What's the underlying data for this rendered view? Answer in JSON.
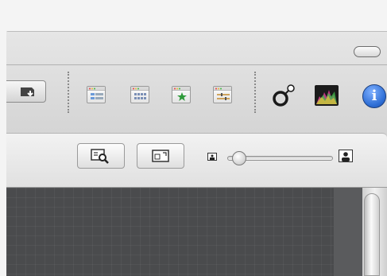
{
  "toolbar": {
    "left_button_icon": "folder-arrow-icon",
    "view_icons": [
      {
        "name": "list-view-icon"
      },
      {
        "name": "grid-view-icon"
      },
      {
        "name": "star-view-icon"
      },
      {
        "name": "adjust-view-icon"
      }
    ],
    "right_icons": [
      {
        "name": "loupe-icon"
      },
      {
        "name": "histogram-icon"
      },
      {
        "name": "info-icon",
        "glyph": "i",
        "color": "#2f6fd6"
      }
    ]
  },
  "panel": {
    "buttons": [
      {
        "name": "zoom-to-fit-icon"
      },
      {
        "name": "fullscreen-icon"
      }
    ],
    "thumbnail_slider": {
      "value_fraction": 0.1
    }
  }
}
